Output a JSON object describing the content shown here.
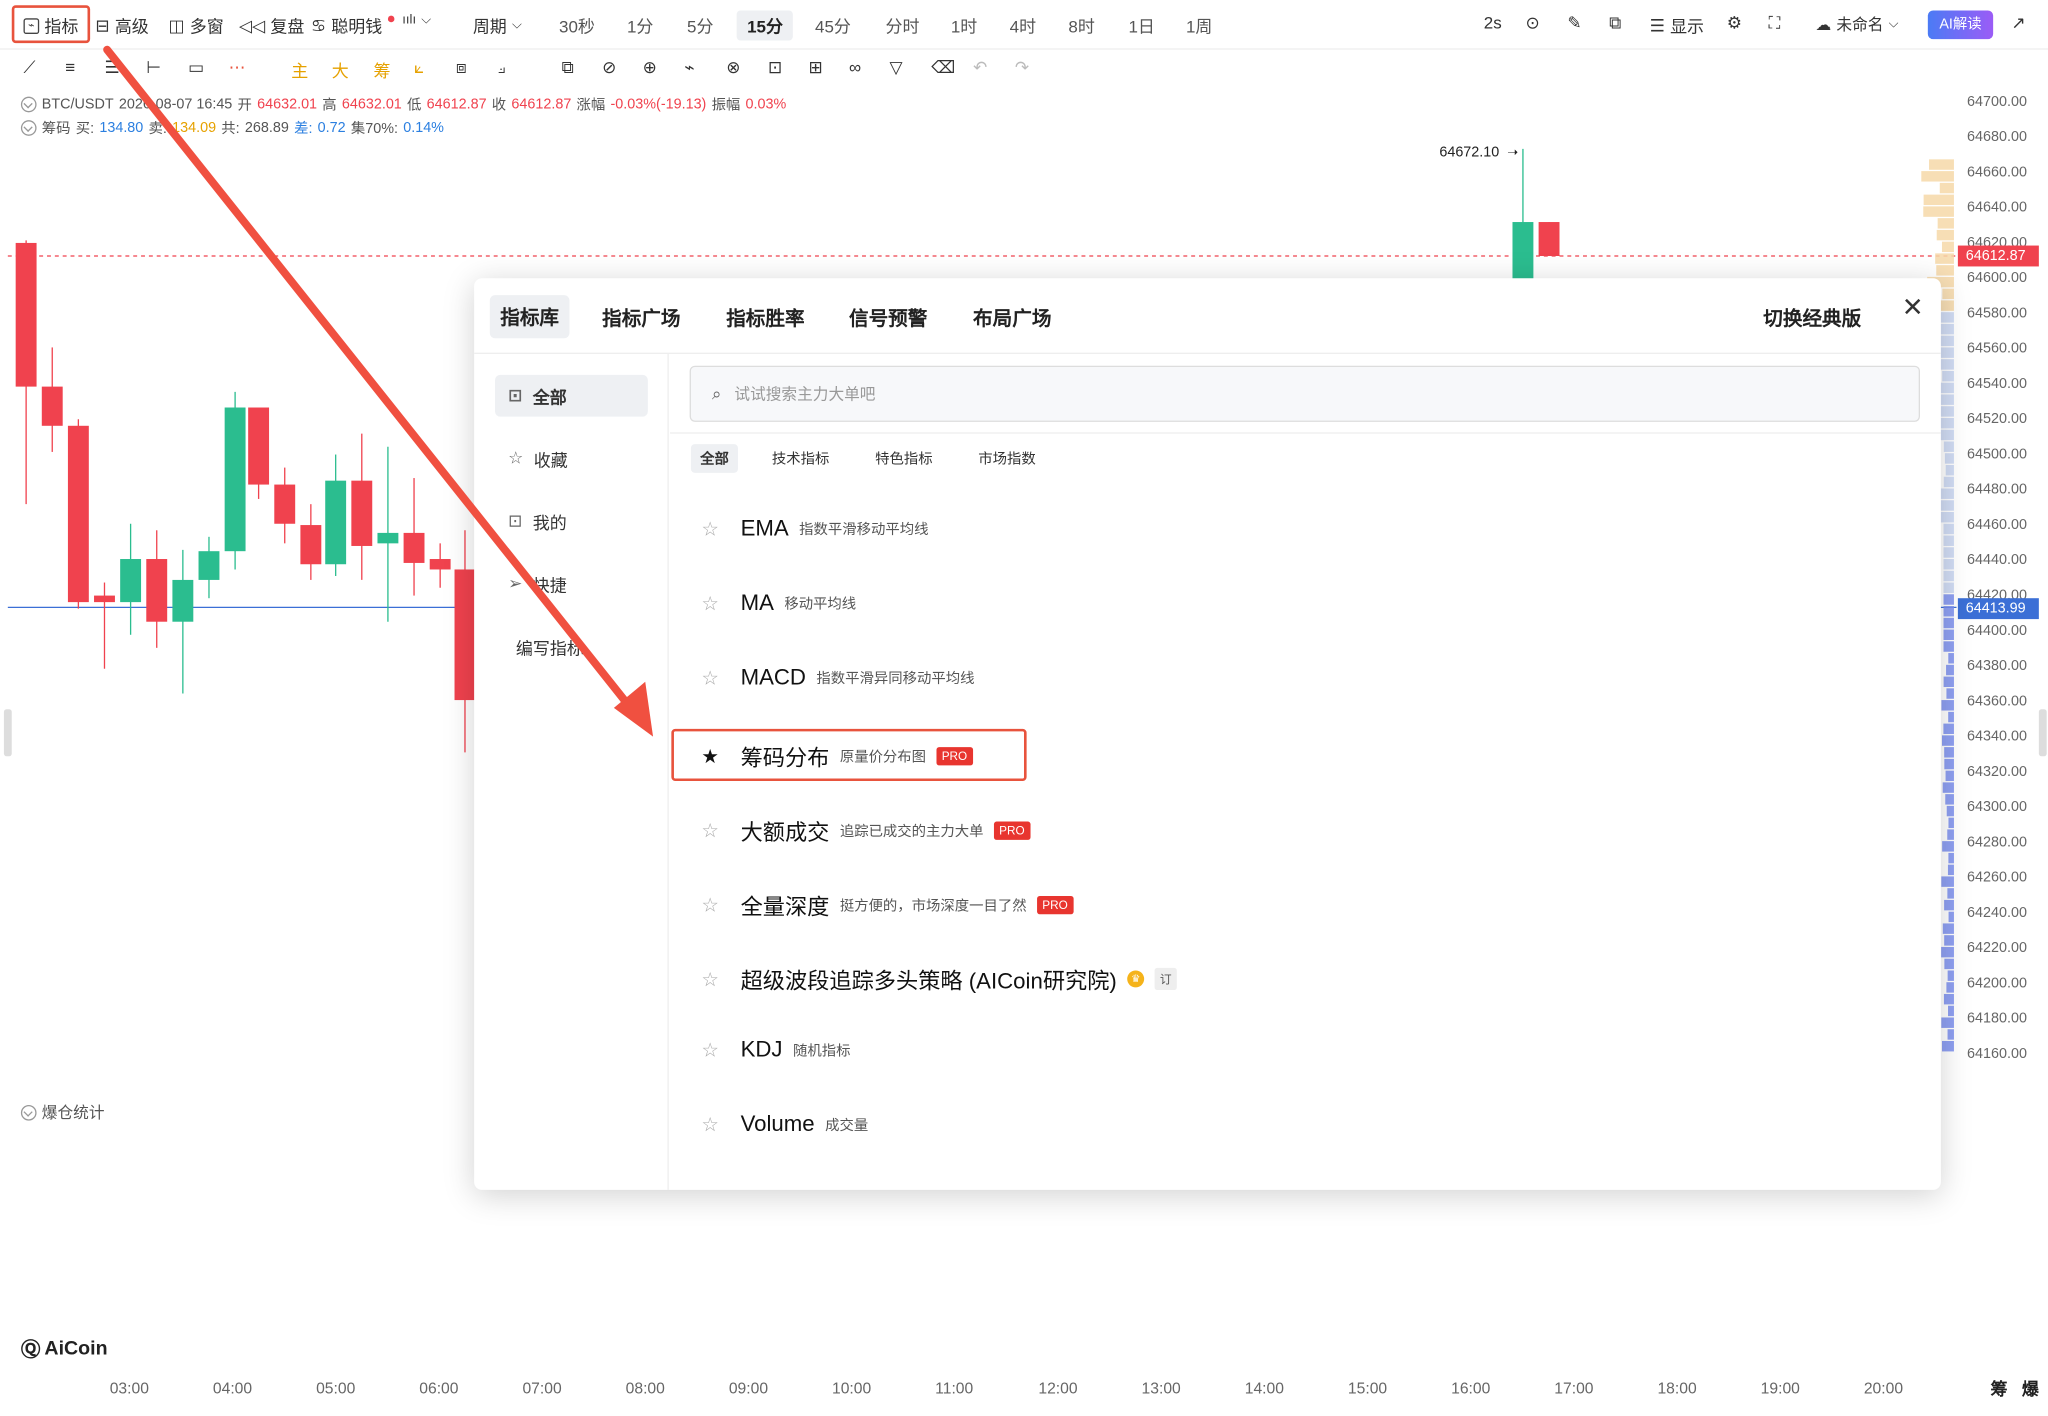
{
  "toolbar": {
    "indicators": "指标",
    "advanced": "高级",
    "multi_window": "多窗",
    "replay": "复盘",
    "smart_money": "聪明钱",
    "period_label": "周期",
    "periods": [
      "30秒",
      "1分",
      "5分",
      "15分",
      "45分",
      "分时",
      "1时",
      "4时",
      "8时",
      "1日",
      "1周"
    ],
    "active_period": "15分",
    "refresh": "2s",
    "display": "显示",
    "layout_name": "未命名",
    "ai_button": "AI解读"
  },
  "drawing_tools": {
    "main": "主",
    "big": "大",
    "chips": "筹"
  },
  "info": {
    "symbol": "BTC/USDT",
    "datetime": "2026-08-07 16:45",
    "open_label": "开",
    "open": "64632.01",
    "high_label": "高",
    "high": "64632.01",
    "low_label": "低",
    "low": "64612.87",
    "close_label": "收",
    "close": "64612.87",
    "change_label": "涨幅",
    "change": "-0.03%(-19.13)",
    "amp_label": "振幅",
    "amp": "0.03%",
    "chip_label": "筹码",
    "buy_label": "买:",
    "buy": "134.80",
    "sell_label": "卖:",
    "sell": "134.09",
    "total_label": "共:",
    "total": "268.89",
    "diff_label": "差:",
    "diff": "0.72",
    "conc_label": "集70%:",
    "conc": "0.14%",
    "liquidation": "爆仓统计"
  },
  "chart": {
    "peak_label": "64672.10",
    "last_price": "64612.87",
    "line_price": "64413.99",
    "y_ticks": [
      "64700.00",
      "64680.00",
      "64660.00",
      "64640.00",
      "64620.00",
      "64600.00",
      "64580.00",
      "64560.00",
      "64540.00",
      "64520.00",
      "64500.00",
      "64480.00",
      "64460.00",
      "64440.00",
      "64420.00",
      "64400.00",
      "64380.00",
      "64360.00",
      "64340.00",
      "64320.00",
      "64300.00",
      "64280.00",
      "64260.00",
      "64240.00",
      "64220.00",
      "64200.00",
      "64180.00",
      "64160.00"
    ],
    "x_ticks": [
      "03:00",
      "04:00",
      "05:00",
      "06:00",
      "07:00",
      "08:00",
      "09:00",
      "10:00",
      "11:00",
      "12:00",
      "13:00",
      "14:00",
      "15:00",
      "16:00",
      "17:00",
      "18:00",
      "19:00",
      "20:00"
    ],
    "corner_labels": [
      "筹",
      "爆"
    ],
    "logo": "AiCoin",
    "colors": {
      "up": "#2bbd8f",
      "down": "#f0424e",
      "line": "#3b6fd6"
    }
  },
  "modal": {
    "tabs": [
      "指标库",
      "指标广场",
      "指标胜率",
      "信号预警",
      "布局广场"
    ],
    "active_tab": "指标库",
    "switch_classic": "切换经典版",
    "sidebar": [
      "全部",
      "收藏",
      "我的",
      "快捷",
      "编写指标"
    ],
    "search_placeholder": "试试搜索主力大单吧",
    "filters": [
      "全部",
      "技术指标",
      "特色指标",
      "市场指数"
    ],
    "indicators": [
      {
        "name": "EMA",
        "desc": "指数平滑移动平均线",
        "badge": "",
        "starred": false
      },
      {
        "name": "MA",
        "desc": "移动平均线",
        "badge": "",
        "starred": false
      },
      {
        "name": "MACD",
        "desc": "指数平滑异同移动平均线",
        "badge": "",
        "starred": false
      },
      {
        "name": "筹码分布",
        "desc": "原量价分布图",
        "badge": "PRO",
        "starred": true
      },
      {
        "name": "大额成交",
        "desc": "追踪已成交的主力大单",
        "badge": "PRO",
        "starred": false
      },
      {
        "name": "全量深度",
        "desc": "挺方便的，市场深度一目了然",
        "badge": "PRO",
        "starred": false
      },
      {
        "name": "超级波段追踪多头策略 (AICoin研究院)",
        "desc": "",
        "badge": "订",
        "starred": false
      },
      {
        "name": "KDJ",
        "desc": "随机指标",
        "badge": "",
        "starred": false
      },
      {
        "name": "Volume",
        "desc": "成交量",
        "badge": "",
        "starred": false
      }
    ]
  }
}
